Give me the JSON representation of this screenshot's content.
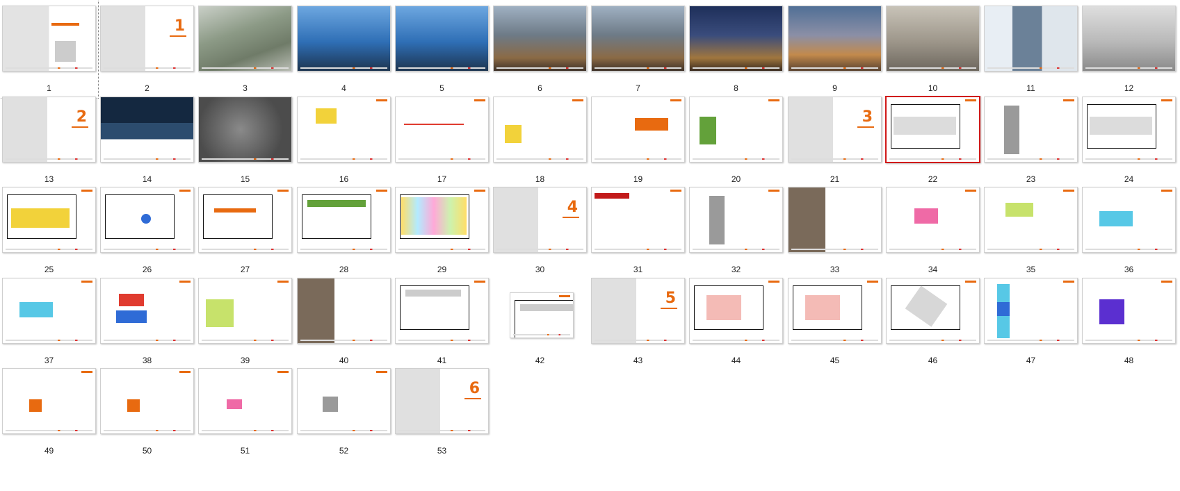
{
  "slides": [
    {
      "number": "1",
      "v": "cover"
    },
    {
      "number": "2",
      "v": "section",
      "glyph": "1"
    },
    {
      "number": "3",
      "v": "aerial"
    },
    {
      "number": "4",
      "v": "sky"
    },
    {
      "number": "5",
      "v": "sky"
    },
    {
      "number": "6",
      "v": "street"
    },
    {
      "number": "7",
      "v": "street"
    },
    {
      "number": "8",
      "v": "night"
    },
    {
      "number": "9",
      "v": "dusk"
    },
    {
      "number": "10",
      "v": "interior"
    },
    {
      "number": "11",
      "v": "tower"
    },
    {
      "number": "12",
      "v": "mall"
    },
    {
      "number": "13",
      "v": "section",
      "glyph": "2"
    },
    {
      "number": "14",
      "v": "lake"
    },
    {
      "number": "15",
      "v": "map"
    },
    {
      "number": "16",
      "v": "plan",
      "extra": "zoning"
    },
    {
      "number": "17",
      "v": "plan",
      "extra": "route"
    },
    {
      "number": "18",
      "v": "plan",
      "extra": "arrows"
    },
    {
      "number": "19",
      "v": "plan",
      "extra": "table"
    },
    {
      "number": "20",
      "v": "plan",
      "extra": "greenblock"
    },
    {
      "number": "21",
      "v": "section",
      "glyph": "3"
    },
    {
      "number": "22",
      "v": "plan",
      "extra": "site"
    },
    {
      "number": "23",
      "v": "plan",
      "extra": "axo"
    },
    {
      "number": "24",
      "v": "plan",
      "extra": "site"
    },
    {
      "number": "25",
      "v": "planyellow",
      "extra": "yellow"
    },
    {
      "number": "26",
      "v": "planyellow",
      "extra": "blue"
    },
    {
      "number": "27",
      "v": "planyellow",
      "extra": "orange"
    },
    {
      "number": "28",
      "v": "planyellow",
      "extra": "green"
    },
    {
      "number": "29",
      "v": "rainbow"
    },
    {
      "number": "30",
      "v": "section",
      "glyph": "4"
    },
    {
      "number": "31",
      "v": "plan",
      "extra": "redbar"
    },
    {
      "number": "32",
      "v": "plan",
      "extra": "axo"
    },
    {
      "number": "33",
      "v": "photoset"
    },
    {
      "number": "34",
      "v": "plan",
      "extra": "pink"
    },
    {
      "number": "35",
      "v": "plan",
      "extra": "lime"
    },
    {
      "number": "36",
      "v": "plan",
      "extra": "cyan"
    },
    {
      "number": "37",
      "v": "plan",
      "extra": "cyan"
    },
    {
      "number": "38",
      "v": "plan",
      "extra": "redblue"
    },
    {
      "number": "39",
      "v": "plan",
      "extra": "limepattern"
    },
    {
      "number": "40",
      "v": "photoset"
    },
    {
      "number": "41",
      "v": "plan",
      "extra": "strip"
    },
    {
      "number": "42",
      "v": "plan",
      "extra": "strip",
      "small": true
    },
    {
      "number": "43",
      "v": "section",
      "glyph": "5"
    },
    {
      "number": "44",
      "v": "plan",
      "extra": "office"
    },
    {
      "number": "45",
      "v": "plan",
      "extra": "office"
    },
    {
      "number": "46",
      "v": "plan",
      "extra": "officediag"
    },
    {
      "number": "47",
      "v": "plan",
      "extra": "stack"
    },
    {
      "number": "48",
      "v": "plan",
      "extra": "purple"
    },
    {
      "number": "49",
      "v": "plan",
      "extra": "floor"
    },
    {
      "number": "50",
      "v": "plan",
      "extra": "floor"
    },
    {
      "number": "51",
      "v": "plan",
      "extra": "floorpink"
    },
    {
      "number": "52",
      "v": "plan",
      "extra": "floorgray"
    },
    {
      "number": "53",
      "v": "section",
      "glyph": "6"
    }
  ],
  "selected_slide": "22",
  "focused_slide": "1"
}
